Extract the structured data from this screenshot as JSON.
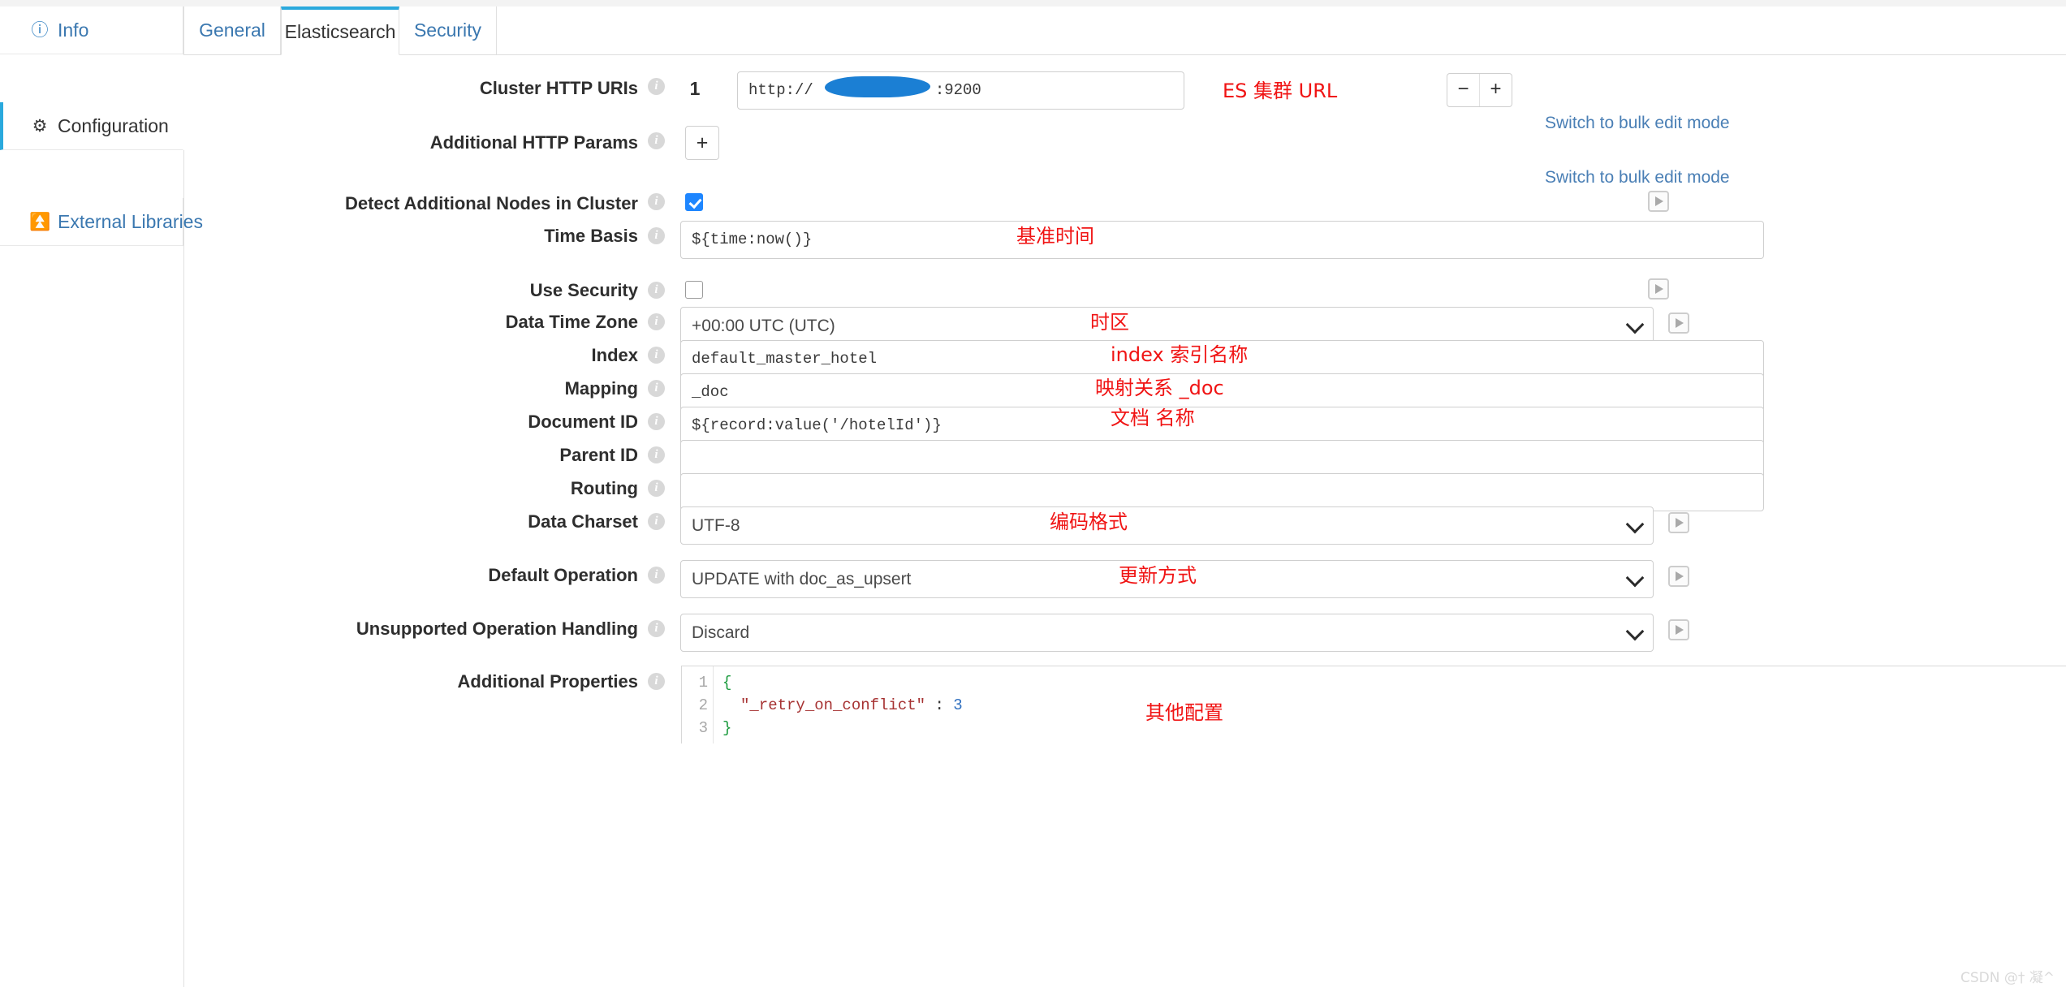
{
  "sidebar": {
    "items": [
      {
        "label": "Info",
        "icon": "info-circle-icon",
        "active": false
      },
      {
        "label": "Configuration",
        "icon": "gear-icon",
        "active": true
      },
      {
        "label": "External Libraries",
        "icon": "upload-icon",
        "active": false
      }
    ]
  },
  "tabs": [
    {
      "label": "General",
      "active": false
    },
    {
      "label": "Elasticsearch",
      "active": true
    },
    {
      "label": "Security",
      "active": false
    }
  ],
  "form": {
    "cluster_http_uris": {
      "label": "Cluster HTTP URIs",
      "index": "1",
      "value": "http://                    :9200",
      "value_prefix": "http://",
      "value_suffix": ":9200",
      "annotation": "ES 集群 URL",
      "minus_label": "−",
      "plus_label": "+",
      "bulk_link": "Switch to bulk edit mode"
    },
    "additional_http_params": {
      "label": "Additional HTTP Params",
      "add_label": "+",
      "bulk_link": "Switch to bulk edit mode"
    },
    "detect_additional_nodes": {
      "label": "Detect Additional Nodes in Cluster",
      "checked": true
    },
    "time_basis": {
      "label": "Time Basis",
      "value": "${time:now()}",
      "annotation": "基准时间"
    },
    "use_security": {
      "label": "Use Security",
      "checked": false
    },
    "data_time_zone": {
      "label": "Data Time Zone",
      "value": "+00:00 UTC (UTC)",
      "annotation": "时区"
    },
    "index": {
      "label": "Index",
      "value": "default_master_hotel",
      "annotation": "index 索引名称"
    },
    "mapping": {
      "label": "Mapping",
      "value": "_doc",
      "annotation": "映射关系 _doc"
    },
    "document_id": {
      "label": "Document ID",
      "value": "${record:value('/hotelId')}",
      "annotation": "文档 名称"
    },
    "parent_id": {
      "label": "Parent ID",
      "value": ""
    },
    "routing": {
      "label": "Routing",
      "value": ""
    },
    "data_charset": {
      "label": "Data Charset",
      "value": "UTF-8",
      "annotation": "编码格式"
    },
    "default_operation": {
      "label": "Default Operation",
      "value": "UPDATE with doc_as_upsert",
      "annotation": "更新方式"
    },
    "unsupported_operation_handling": {
      "label": "Unsupported Operation Handling",
      "value": "Discard"
    },
    "additional_properties": {
      "label": "Additional Properties",
      "annotation": "其他配置",
      "line_numbers": [
        "1",
        "2",
        "3"
      ],
      "lines": [
        {
          "open": "{"
        },
        {
          "key": "\"_retry_on_conflict\"",
          "punct": " : ",
          "num": "3"
        },
        {
          "close": "}"
        }
      ]
    }
  },
  "info_icon_glyph": "i",
  "watermark": "CSDN @† 凝^",
  "colors": {
    "accent": "#2aa9dd",
    "link": "#3b78b0",
    "annotation": "#f01414",
    "checkbox_on": "#1e86ff",
    "redaction": "#1b7fd4"
  }
}
